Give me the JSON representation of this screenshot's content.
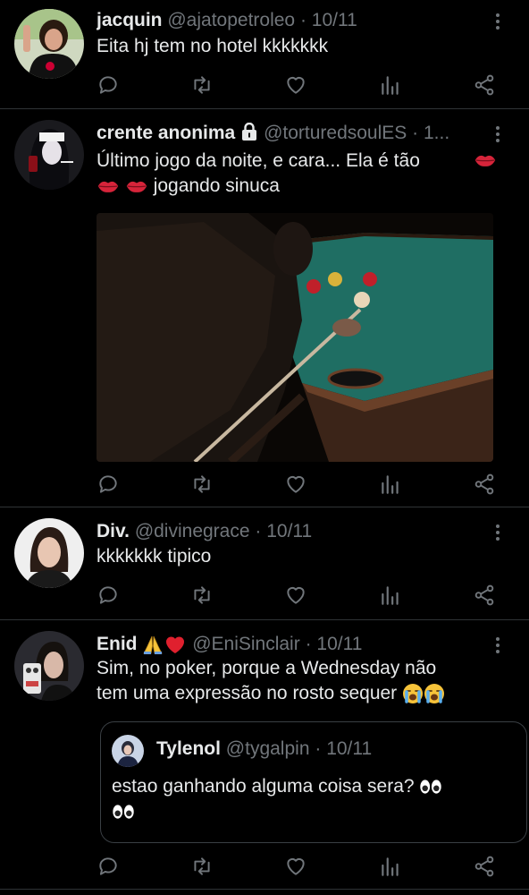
{
  "tweets": [
    {
      "name": "jacquin",
      "handle": "@ajatopetroleo",
      "separator": "·",
      "time": "10/11",
      "text": "Eita hj tem no hotel kkkkkkk"
    },
    {
      "name": "crente anonima",
      "handle": "@torturedsoulES",
      "separator": "·",
      "time": "1...",
      "text_line1": "Último jogo da noite, e cara... Ela é tão",
      "text_line2": "jogando sinuca"
    },
    {
      "name": "Div.",
      "handle": "@divinegrace",
      "separator": "·",
      "time": "10/11",
      "text": "kkkkkkk tipico"
    },
    {
      "name": "Enid",
      "handle": "@EniSinclair",
      "separator": "·",
      "time": "10/11",
      "text_line1": "Sim, no poker, porque a Wednesday não",
      "text_line2": "tem uma expressão no rosto sequer",
      "quote": {
        "name": "Tylenol",
        "handle": "@tygalpin",
        "separator": "·",
        "time": "10/11",
        "text": "estao ganhando alguma coisa sera?"
      }
    }
  ],
  "icons": {
    "reply": "reply-icon",
    "retweet": "retweet-icon",
    "like": "heart-icon",
    "views": "views-icon",
    "share": "share-icon",
    "more": "more-icon",
    "lock": "lock-icon"
  },
  "colors": {
    "background": "#000000",
    "text": "#e7e9ea",
    "muted": "#71767b",
    "divider": "#2f3336",
    "pool_felt": "#1f6e63"
  }
}
